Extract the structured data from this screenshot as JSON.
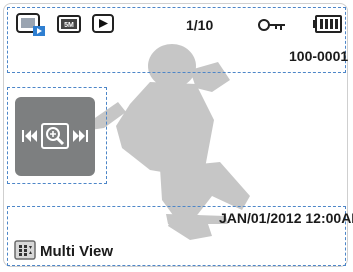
{
  "status": {
    "counter": "1/10",
    "file_number": "100-0001",
    "datetime": "JAN/01/2012 12:00AM"
  },
  "icons": {
    "mode": "photo-playback-mode-icon",
    "resolution": "photo-size-icon",
    "playback": "play-mode-icon",
    "protect": "key-protect-icon",
    "battery": "battery-icon",
    "nav": "zoom-skip-nav-icon",
    "multi_view": "multi-view-icon"
  },
  "bottom": {
    "label": "Multi View"
  },
  "colors": {
    "guide_dash": "#4d86c8",
    "nav_panel": "#7d7f80",
    "silhouette": "#c8c8c8"
  }
}
